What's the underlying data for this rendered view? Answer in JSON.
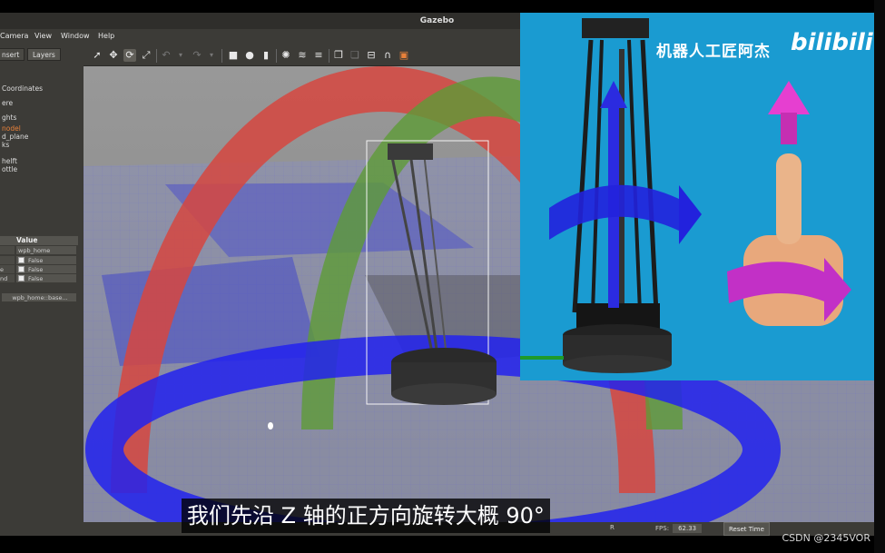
{
  "window": {
    "title": "Gazebo"
  },
  "menu": [
    "Camera",
    "View",
    "Window",
    "Help"
  ],
  "left_panel": {
    "tabs": [
      "nsert",
      "Layers"
    ],
    "tree": [
      " Coordinates",
      "ere",
      "ghts",
      "nodel",
      "d_plane",
      "ks",
      "helft",
      "ottle"
    ],
    "properties": {
      "header": "Value",
      "rows": [
        {
          "name": "",
          "value": "wpb_home"
        },
        {
          "name": "",
          "value": "False",
          "checkbox": true
        },
        {
          "name": "e",
          "value": "False",
          "checkbox": true
        },
        {
          "name": "nd",
          "value": "False",
          "checkbox": true
        }
      ],
      "selected_link": "wpb_home::base..."
    }
  },
  "toolbar": {
    "icons": [
      "select-arrow",
      "translate",
      "rotate",
      "scale",
      "undo",
      "undo-dropdown",
      "redo",
      "redo-dropdown",
      "box",
      "sphere",
      "cylinder",
      "point-light",
      "spot-light",
      "directional-light",
      "copy",
      "paste",
      "align",
      "snap",
      "change-view"
    ]
  },
  "status": {
    "fps_label": "FPS:",
    "fps_value": "62.33",
    "reset_time": "Reset Time",
    "partial": "R"
  },
  "overlay": {
    "caption": "机器人工匠阿杰",
    "logo": "bilibili"
  },
  "subtitle": "我们先沿 Z 轴的正方向旋转大概 90°",
  "watermark": "CSDN @2345VOR",
  "colors": {
    "ring_red": "#d6463f",
    "ring_green": "#5e9b37",
    "ring_blue": "#2222ee",
    "overlay_bg": "#1a9bd1",
    "accent": "#e8813a"
  }
}
